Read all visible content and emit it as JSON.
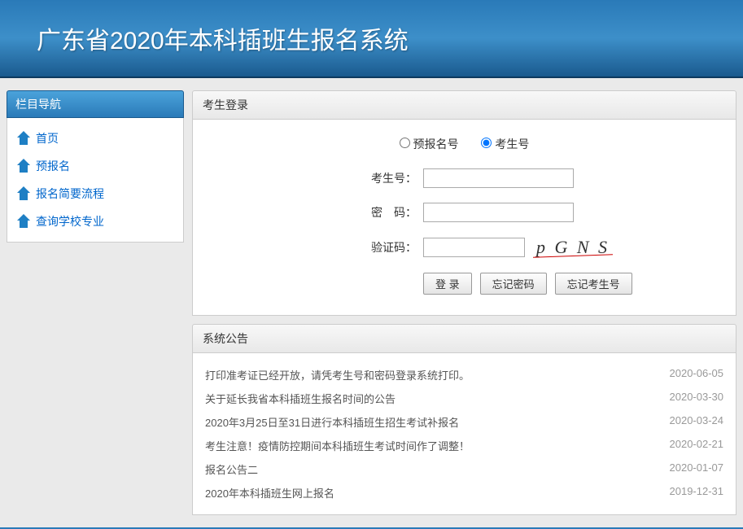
{
  "header": {
    "title": "广东省2020年本科插班生报名系统"
  },
  "sidebar": {
    "title": "栏目导航",
    "items": [
      {
        "label": "首页"
      },
      {
        "label": "预报名"
      },
      {
        "label": "报名简要流程"
      },
      {
        "label": "查询学校专业"
      }
    ]
  },
  "login": {
    "title": "考生登录",
    "radio_prereg": "预报名号",
    "radio_examid": "考生号",
    "label_examid": "考生号：",
    "label_password": "密　码：",
    "label_captcha": "验证码：",
    "captcha_text": "p G N S",
    "btn_login": "登 录",
    "btn_forgot_pwd": "忘记密码",
    "btn_forgot_id": "忘记考生号"
  },
  "announcements": {
    "title": "系统公告",
    "items": [
      {
        "text": "打印准考证已经开放，请凭考生号和密码登录系统打印。",
        "date": "2020-06-05"
      },
      {
        "text": "关于延长我省本科插班生报名时间的公告",
        "date": "2020-03-30"
      },
      {
        "text": "2020年3月25日至31日进行本科插班生招生考试补报名",
        "date": "2020-03-24"
      },
      {
        "text": "考生注意！疫情防控期间本科插班生考试时间作了调整！",
        "date": "2020-02-21"
      },
      {
        "text": "报名公告二",
        "date": "2020-01-07"
      },
      {
        "text": "2020年本科插班生网上报名",
        "date": "2019-12-31"
      }
    ]
  }
}
